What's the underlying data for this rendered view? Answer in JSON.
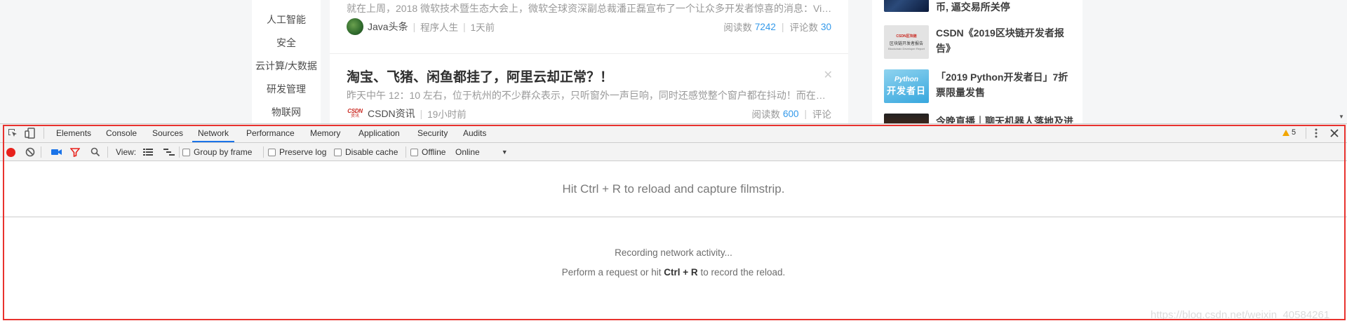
{
  "left_nav": {
    "items": [
      "人工智能",
      "安全",
      "云计算/大数据",
      "研发管理",
      "物联网"
    ]
  },
  "feed": {
    "articles": [
      {
        "title": "",
        "desc": "就在上周，2018 微软技术暨生态大会上，微软全球资深副总裁潘正磊宣布了一个让众多开发者惊喜的消息：Visu...",
        "source": "Java头条",
        "tag": "程序人生",
        "time": "1天前",
        "reads_label": "阅读数",
        "reads": "7242",
        "comments_label": "评论数",
        "comments": "30"
      },
      {
        "title": "淘宝、飞猪、闲鱼都挂了，阿里云却正常？！",
        "desc": "昨天中午 12：10 左右，位于杭州的不少群众表示，只听窗外一声巨响，同时还感觉整个窗户都在抖动！而在今天...",
        "source": "CSDN资讯",
        "logo_text": "CSDN",
        "logo_sub": "资讯",
        "time": "19小时前",
        "reads_label": "阅读数",
        "reads": "600",
        "comments_label": "评论"
      }
    ]
  },
  "right_col": {
    "items": [
      {
        "title": "币, 逼交易所关停"
      },
      {
        "title": "CSDN《2019区块链开发者报告》",
        "thumb_text": [
          "CSDN区块链",
          "区块链开发者报告",
          "Blockchain Developer Report"
        ]
      },
      {
        "title": "「2019 Python开发者日」7折票限量发售",
        "thumb_text": [
          "Python",
          "开发者日"
        ]
      },
      {
        "title": "今晚直播｜聊天机器人落地及进"
      }
    ]
  },
  "devtools": {
    "tabs": [
      "Elements",
      "Console",
      "Sources",
      "Network",
      "Performance",
      "Memory",
      "Application",
      "Security",
      "Audits"
    ],
    "active_tab": "Network",
    "warnings_count": "5",
    "toolbar": {
      "view_label": "View:",
      "group_by_frame": "Group by frame",
      "preserve_log": "Preserve log",
      "disable_cache": "Disable cache",
      "offline": "Offline",
      "throttle_value": "Online"
    },
    "filmstrip_hint": "Hit Ctrl + R to reload and capture filmstrip.",
    "recording": {
      "line1": "Recording network activity...",
      "line2_pre": "Perform a request or hit ",
      "line2_key": "Ctrl + R",
      "line2_post": " to record the reload."
    }
  },
  "watermark": "https://blog.csdn.net/weixin_40584261",
  "colors": {
    "accent": "#1a73e8",
    "link_number": "#3399ea",
    "record_red": "#e8221c",
    "highlight_box": "#e8322e",
    "warning": "#f2a600"
  }
}
